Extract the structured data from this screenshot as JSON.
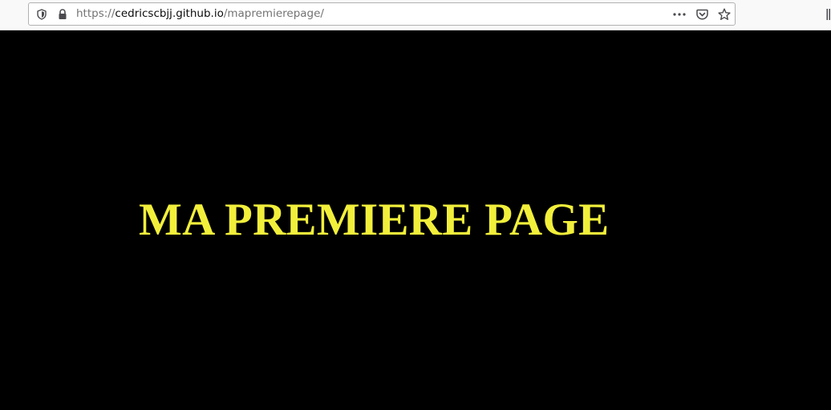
{
  "browser": {
    "url_scheme": "https://",
    "url_host": "cedricscbjj.github.io",
    "url_path": "/mapremierepage/",
    "icons": {
      "tracking_protection": "shield-icon",
      "security": "lock-icon",
      "page_actions": "more-horizontal-icon",
      "pocket": "pocket-icon",
      "bookmark": "star-icon",
      "library": "library-icon"
    }
  },
  "page": {
    "heading": "MA PREMIERE PAGE"
  },
  "colors": {
    "page_background": "#000000",
    "heading": "#f2ef3b",
    "toolbar_background": "#f9f9fa",
    "icon": "#4a4a4f"
  }
}
